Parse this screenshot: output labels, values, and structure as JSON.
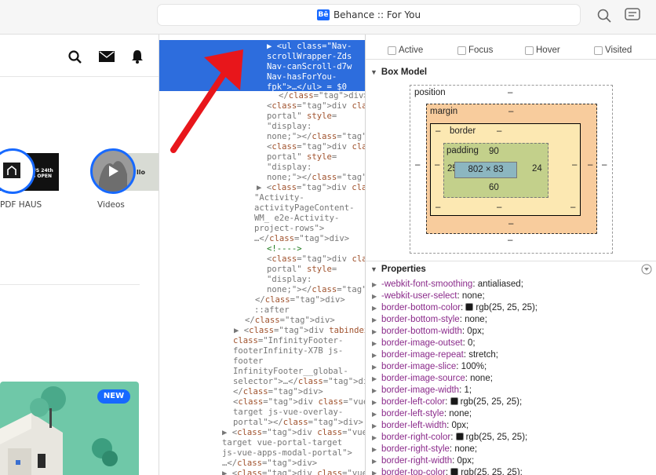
{
  "browser": {
    "tab_title": "Behance :: For You",
    "site_badge": "Bē"
  },
  "left_panel": {
    "items": [
      {
        "label": "PDF HAUS",
        "thumb_text": "US 24th\nS OPEN"
      },
      {
        "label": "Videos",
        "thumb_text": "llo"
      }
    ],
    "card_badge": "NEW"
  },
  "dom_lines": [
    {
      "t": "▶ <ul class=\"Nav-",
      "sel": true
    },
    {
      "t": "scrollWrapper-Zds",
      "sel": true
    },
    {
      "t": "Nav-canScroll-d7w",
      "sel": true
    },
    {
      "t": "Nav-hasForYou-",
      "sel": true
    },
    {
      "t": "fpk\">…</ul> = $0",
      "sel": true
    },
    {
      "t": "</div>"
    },
    {
      "t": "<div class=\"v-"
    },
    {
      "t": "portal\" style="
    },
    {
      "t": "\"display:"
    },
    {
      "t": "none;\"></div>"
    },
    {
      "t": "<div class=\"v-"
    },
    {
      "t": "portal\" style="
    },
    {
      "t": "\"display:"
    },
    {
      "t": "none;\"></div>"
    },
    {
      "t": "▶ <div class="
    },
    {
      "t": "\"Activity-"
    },
    {
      "t": "activityPageContent-"
    },
    {
      "t": "WM_ e2e-Activity-"
    },
    {
      "t": "project-rows\">"
    },
    {
      "t": "…</div>"
    },
    {
      "t": "<!---->"
    },
    {
      "t": "<div class=\"v-"
    },
    {
      "t": "portal\" style="
    },
    {
      "t": "\"display:"
    },
    {
      "t": "none;\"></div>"
    },
    {
      "t": "</div>"
    },
    {
      "t": "::after"
    },
    {
      "t": "</div>"
    },
    {
      "t": "▶ <div tabindex=\"0\""
    },
    {
      "t": "class=\"InfinityFooter-"
    },
    {
      "t": "footerInfinity-X7B js-"
    },
    {
      "t": "footer"
    },
    {
      "t": "InfinityFooter__global-"
    },
    {
      "t": "selector\">…</div>"
    },
    {
      "t": "</div>"
    },
    {
      "t": "<div class=\"vue-portal-"
    },
    {
      "t": "target js-vue-overlay-"
    },
    {
      "t": "portal\"></div>"
    },
    {
      "t": "▶ <div class=\"vue-portal-"
    },
    {
      "t": "target vue-portal-target"
    },
    {
      "t": "js-vue-apps-modal-portal\">"
    },
    {
      "t": "…</div>"
    },
    {
      "t": "▶ <div class=\"vue-portal-"
    }
  ],
  "states": [
    "Active",
    "Focus",
    "Hover",
    "Visited"
  ],
  "box_model": {
    "title": "Box Model",
    "position_label": "position",
    "margin_label": "margin",
    "border_label": "border",
    "padding_label": "padding",
    "dash": "–",
    "content": "802 × 83",
    "padding_top": "90",
    "padding_left": "25",
    "padding_right": "24",
    "padding_bottom": "60"
  },
  "properties": {
    "title": "Properties",
    "rows": [
      {
        "n": "-webkit-font-smoothing",
        "v": "antialiased;"
      },
      {
        "n": "-webkit-user-select",
        "v": "none;"
      },
      {
        "n": "border-bottom-color",
        "v": "rgb(25, 25, 25);",
        "swatch": "#191919"
      },
      {
        "n": "border-bottom-style",
        "v": "none;"
      },
      {
        "n": "border-bottom-width",
        "v": "0px;"
      },
      {
        "n": "border-image-outset",
        "v": "0;"
      },
      {
        "n": "border-image-repeat",
        "v": "stretch;"
      },
      {
        "n": "border-image-slice",
        "v": "100%;"
      },
      {
        "n": "border-image-source",
        "v": "none;"
      },
      {
        "n": "border-image-width",
        "v": "1;"
      },
      {
        "n": "border-left-color",
        "v": "rgb(25, 25, 25);",
        "swatch": "#191919"
      },
      {
        "n": "border-left-style",
        "v": "none;"
      },
      {
        "n": "border-left-width",
        "v": "0px;"
      },
      {
        "n": "border-right-color",
        "v": "rgb(25, 25, 25);",
        "swatch": "#191919"
      },
      {
        "n": "border-right-style",
        "v": "none;"
      },
      {
        "n": "border-right-width",
        "v": "0px;"
      },
      {
        "n": "border-top-color",
        "v": "rgb(25, 25, 25);",
        "swatch": "#191919"
      }
    ]
  },
  "colors": {
    "selection": "#2d6ddd",
    "annotation_arrow": "#e8161b",
    "accent": "#1769ff"
  }
}
